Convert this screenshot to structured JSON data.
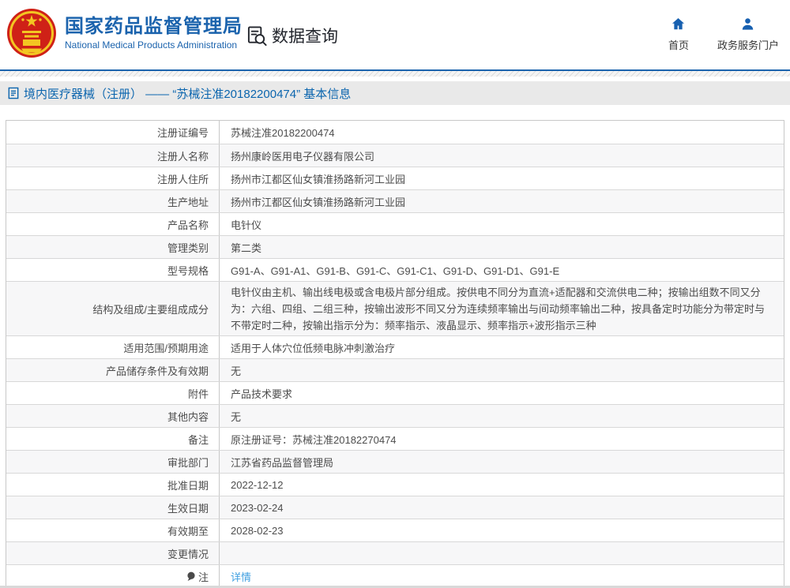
{
  "header": {
    "logo": {
      "title": "国家药品监督管理局",
      "subtitle": "National Medical Products Administration"
    },
    "section_title": "数据查询",
    "nav": [
      {
        "label": "首页",
        "icon": "home-icon"
      },
      {
        "label": "政务服务门户",
        "icon": "user-icon"
      }
    ]
  },
  "breadcrumb": {
    "icon": "doc-icon",
    "text": "境内医疗器械（注册） —— “苏械注准20182200474” 基本信息"
  },
  "table": {
    "rows": [
      {
        "label": "注册证编号",
        "value": "苏械注准20182200474"
      },
      {
        "label": "注册人名称",
        "value": "扬州康岭医用电子仪器有限公司"
      },
      {
        "label": "注册人住所",
        "value": "扬州市江都区仙女镇淮扬路新河工业园"
      },
      {
        "label": "生产地址",
        "value": "扬州市江都区仙女镇淮扬路新河工业园"
      },
      {
        "label": "产品名称",
        "value": "电针仪"
      },
      {
        "label": "管理类别",
        "value": "第二类"
      },
      {
        "label": "型号规格",
        "value": "G91-A、G91-A1、G91-B、G91-C、G91-C1、G91-D、G91-D1、G91-E"
      },
      {
        "label": "结构及组成/主要组成成分",
        "value": "电针仪由主机、输出线电极或含电极片部分组成。按供电不同分为直流+适配器和交流供电二种；按输出组数不同又分为：六组、四组、二组三种，按输出波形不同又分为连续频率输出与间动频率输出二种，按具备定时功能分为带定时与不带定时二种，按输出指示分为：频率指示、液晶显示、频率指示+波形指示三种",
        "tall": true
      },
      {
        "label": "适用范围/预期用途",
        "value": "适用于人体穴位低频电脉冲刺激治疗"
      },
      {
        "label": "产品储存条件及有效期",
        "value": "无"
      },
      {
        "label": "附件",
        "value": "产品技术要求"
      },
      {
        "label": "其他内容",
        "value": "无"
      },
      {
        "label": "备注",
        "value": "原注册证号：苏械注准20182270474"
      },
      {
        "label": "审批部门",
        "value": "江苏省药品监督管理局"
      },
      {
        "label": "批准日期",
        "value": "2022-12-12"
      },
      {
        "label": "生效日期",
        "value": "2023-02-24"
      },
      {
        "label": "有效期至",
        "value": "2028-02-23"
      },
      {
        "label": "变更情况",
        "value": ""
      },
      {
        "label": "注",
        "value": "详情",
        "type": "link",
        "label_icon": "speech-bubble-icon"
      }
    ]
  },
  "icons": {
    "emblem": "national-emblem",
    "query": "doc-search-icon",
    "home": "home-icon",
    "portal": "user-icon",
    "breadcrumb": "doc-icon",
    "note": "speech-bubble-icon"
  },
  "colors": {
    "brand_blue": "#1b63ad",
    "breadcrumb_blue": "#0b65ae",
    "link_blue": "#3f9fe0",
    "text_gray": "#4d4d4d",
    "row_alt_bg": "#f7f7f8",
    "border_gray": "#c8c8c8",
    "emblem_red": "#cf2117",
    "emblem_gold": "#f3c622"
  }
}
